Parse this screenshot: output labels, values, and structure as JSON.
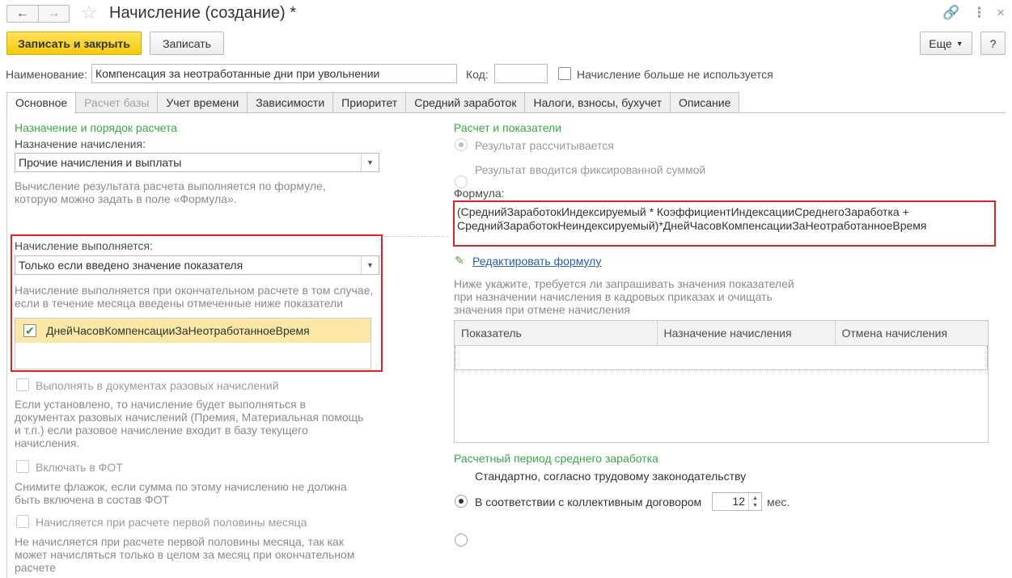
{
  "window": {
    "title": "Начисление (создание) *"
  },
  "toolbar": {
    "save_close": "Записать и закрыть",
    "save": "Записать",
    "more": "Еще",
    "help": "?"
  },
  "header": {
    "name_label": "Наименование:",
    "name_value": "Компенсация за неотработанные дни при увольнении",
    "code_label": "Код:",
    "code_value": "",
    "unused_label": "Начисление больше не используется"
  },
  "tabs": [
    {
      "label": "Основное"
    },
    {
      "label": "Расчет базы"
    },
    {
      "label": "Учет времени"
    },
    {
      "label": "Зависимости"
    },
    {
      "label": "Приоритет"
    },
    {
      "label": "Средний заработок"
    },
    {
      "label": "Налоги, взносы, бухучет"
    },
    {
      "label": "Описание"
    }
  ],
  "left": {
    "section_title": "Назначение и порядок расчета",
    "purpose_label": "Назначение начисления:",
    "purpose_value": "Прочие начисления и выплаты",
    "purpose_hint_1": "Вычисление результата расчета выполняется по формуле,",
    "purpose_hint_2": "которую можно задать в поле «Формула».",
    "performed_label": "Начисление выполняется:",
    "performed_value": "Только если введено значение показателя",
    "performed_hint_1": "Начисление выполняется при окончательном расчете в том случае,",
    "performed_hint_2": "если в течение месяца введены отмеченные ниже показатели",
    "indicator_item": "ДнейЧасовКомпенсацииЗаНеотработанноеВремя",
    "one_time_label": "Выполнять в документах разовых начислений",
    "one_time_hint_1": "Если установлено, то начисление будет выполняться в",
    "one_time_hint_2": "документах разовых начислений (Премия, Материальная помощь",
    "one_time_hint_3": "и т.п.) если разовое начисление входит в базу текущего",
    "one_time_hint_4": "начисления.",
    "fot_label": "Включать в ФОТ",
    "fot_hint_1": "Снимите флажок, если сумма по этому начислению не должна",
    "fot_hint_2": "быть включена в состав ФОТ",
    "half_label": "Начисляется при расчете первой половины месяца",
    "half_hint_1": "Не начисляется при расчете первой половины месяца, так как",
    "half_hint_2": "может начисляться только в целом за месяц при окончательном",
    "half_hint_3": "расчете"
  },
  "right": {
    "section_title": "Расчет и показатели",
    "radio_calc": "Результат рассчитывается",
    "radio_fixed": "Результат вводится фиксированной суммой",
    "formula_label": "Формула:",
    "formula_line_1": "(СреднийЗаработокИндексируемый * КоэффициентИндексацииСреднегоЗаработка +",
    "formula_line_2": "СреднийЗаработокНеиндексируемый)*ДнейЧасовКомпенсацииЗаНеотработанноеВремя",
    "edit_formula": "Редактировать формулу",
    "table_hint_1": "Ниже укажите, требуется ли запрашивать значения показателей",
    "table_hint_2": "при назначении начисления в кадровых приказах и очищать",
    "table_hint_3": "значения при отмене начисления",
    "table_columns": [
      "Показатель",
      "Назначение начисления",
      "Отмена начисления"
    ],
    "period_title": "Расчетный период среднего заработка",
    "period_standard": "Стандартно, согласно трудовому законодательству",
    "period_collective": "В соответствии с коллективным договором",
    "period_months": "12",
    "period_unit": "мес."
  }
}
